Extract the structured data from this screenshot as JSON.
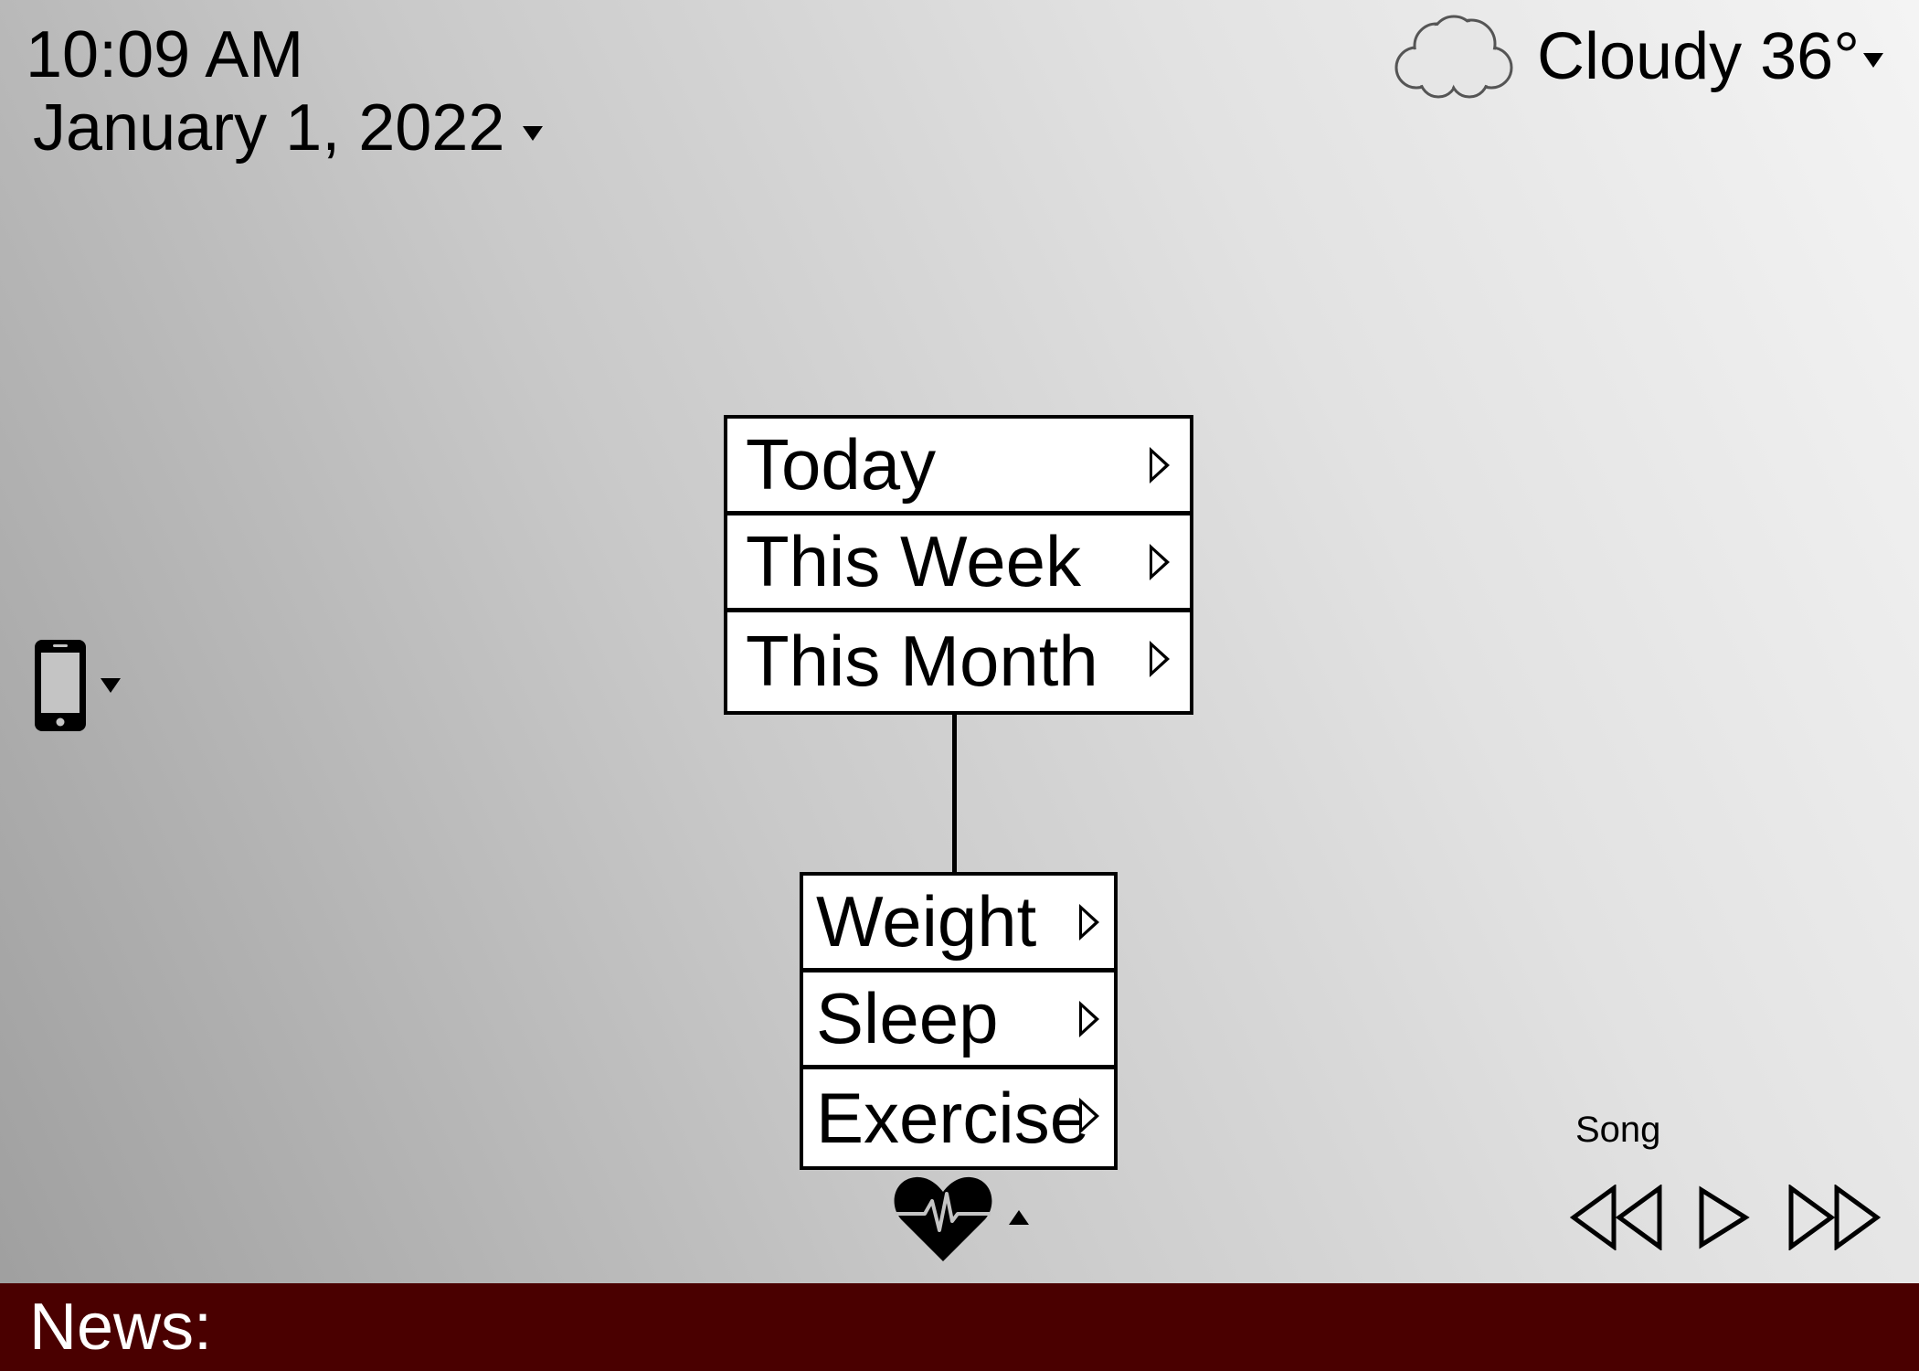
{
  "clock": {
    "time": "10:09 AM",
    "date": "January 1, 2022"
  },
  "weather": {
    "condition_temp": "Cloudy 36°",
    "icon": "cloud-icon"
  },
  "period_menu": {
    "items": [
      {
        "label": "Today"
      },
      {
        "label": "This Week"
      },
      {
        "label": "This Month"
      }
    ]
  },
  "metric_menu": {
    "items": [
      {
        "label": "Weight"
      },
      {
        "label": "Sleep"
      },
      {
        "label": "Exercise"
      }
    ]
  },
  "health": {
    "icon": "heart-pulse-icon"
  },
  "device": {
    "icon": "smartphone-icon"
  },
  "media": {
    "song_label": "Song",
    "controls": [
      "rewind-icon",
      "play-icon",
      "fast-forward-icon"
    ]
  },
  "news": {
    "label": "News:"
  },
  "colors": {
    "news_bar": "#4a0000",
    "text": "#000000"
  }
}
